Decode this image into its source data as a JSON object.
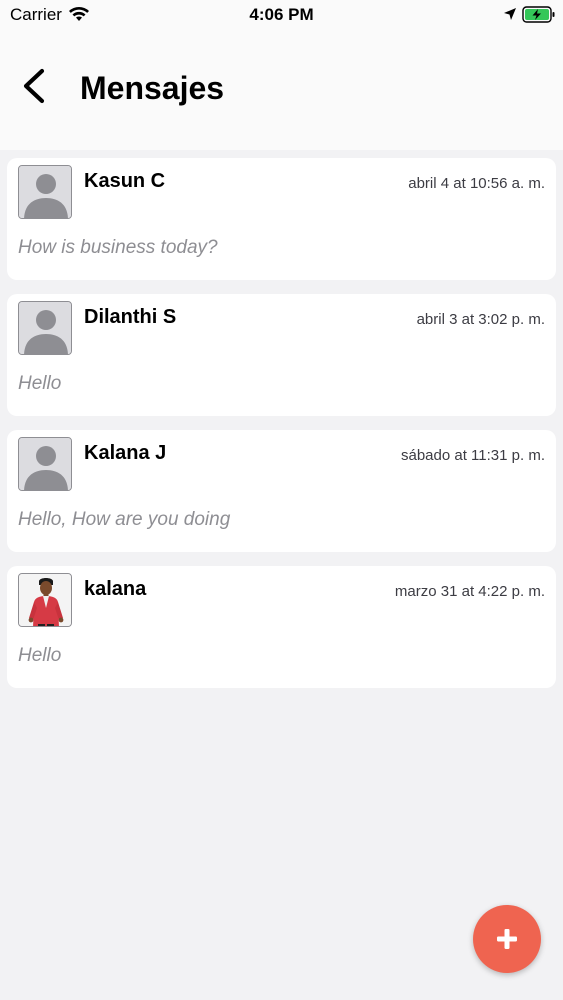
{
  "status_bar": {
    "carrier": "Carrier",
    "time": "4:06 PM"
  },
  "nav": {
    "title": "Mensajes",
    "back_icon": "chevron-left-icon"
  },
  "conversations": [
    {
      "name": "Kasun C",
      "time": "abril 4 at 10:56 a. m.",
      "preview": "How is business today?",
      "avatar": "placeholder"
    },
    {
      "name": "Dilanthi S",
      "time": "abril 3 at 3:02 p. m.",
      "preview": "Hello",
      "avatar": "placeholder"
    },
    {
      "name": "Kalana J",
      "time": "sábado at 11:31 p. m.",
      "preview": "Hello, How are you doing",
      "avatar": "placeholder"
    },
    {
      "name": "kalana",
      "time": "marzo 31 at 4:22 p. m.",
      "preview": "Hello",
      "avatar": "photo"
    }
  ],
  "fab": {
    "icon": "plus-icon",
    "color": "#ef6450"
  },
  "colors": {
    "background": "#f2f2f4",
    "card": "#ffffff",
    "preview_text": "#8e8e93",
    "battery": "#34c759"
  }
}
